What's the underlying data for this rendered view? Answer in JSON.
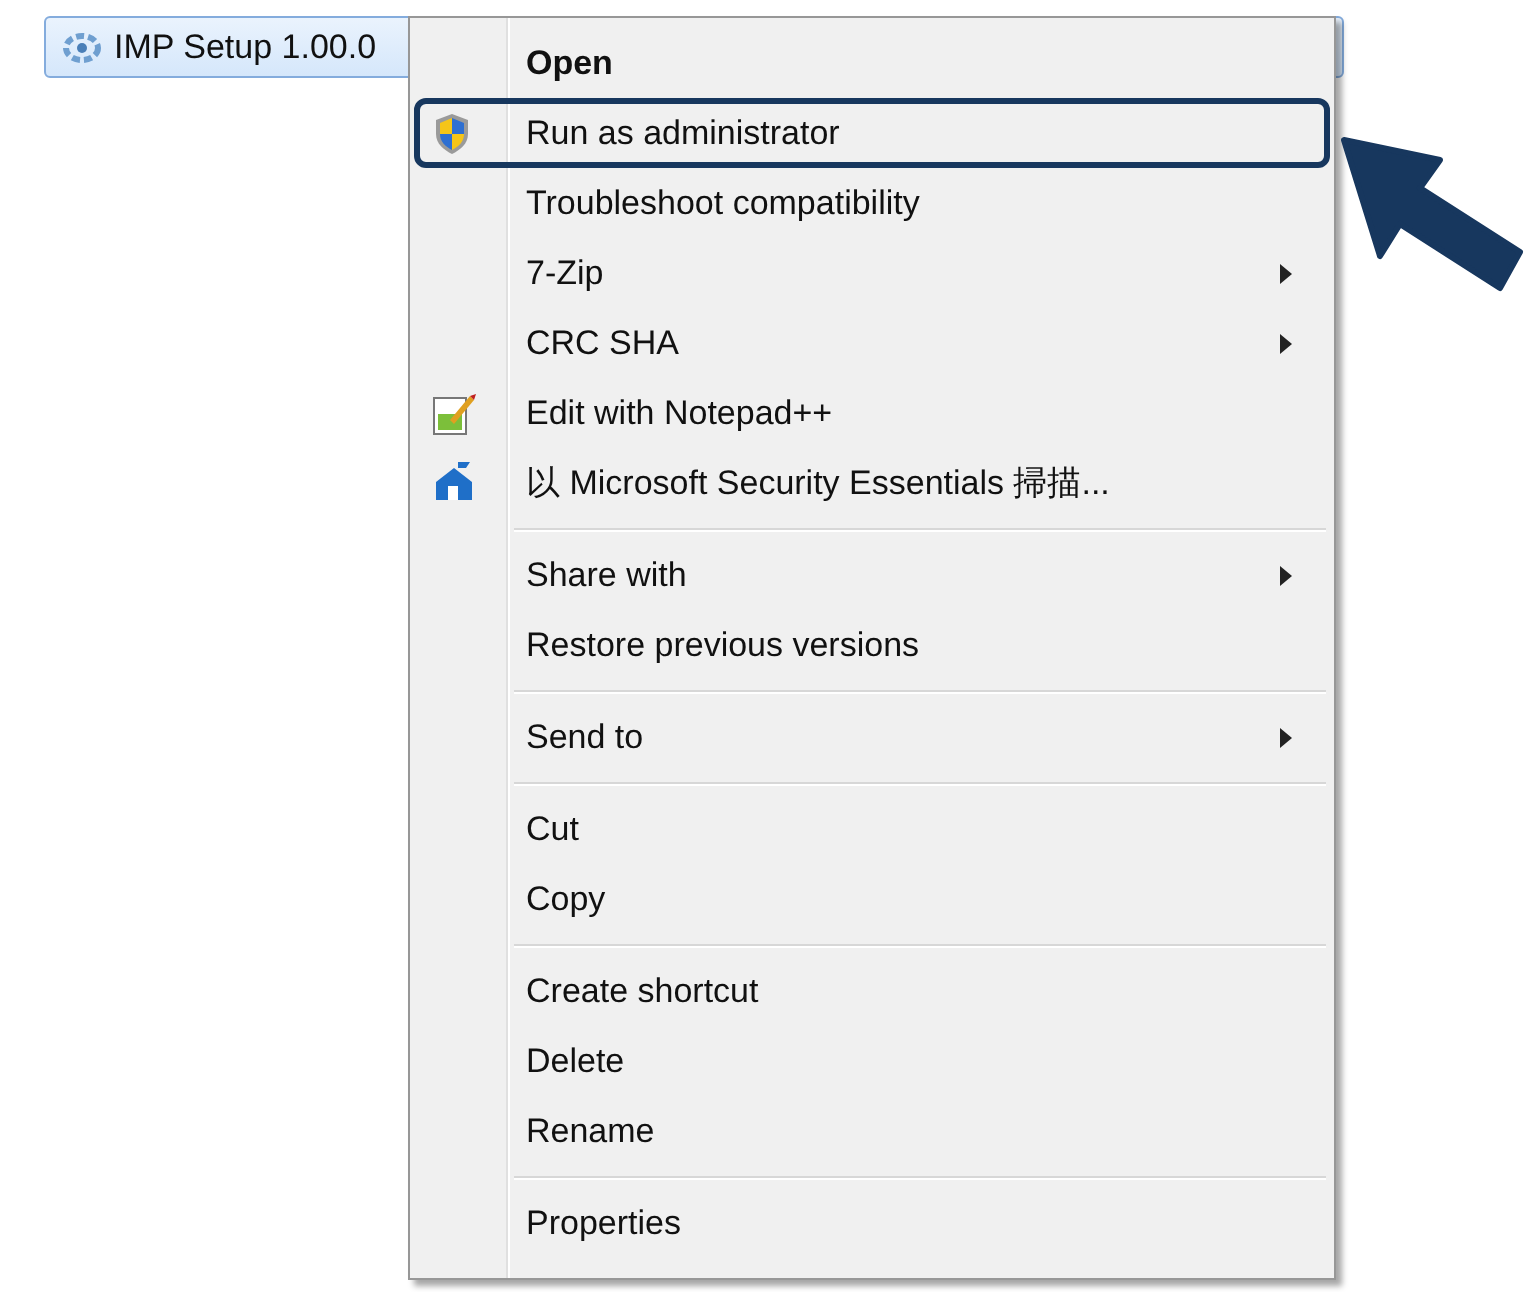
{
  "file": {
    "name": "IMP Setup 1.00.0",
    "selected": true
  },
  "menu": {
    "groups": [
      {
        "items": [
          {
            "label": "Open",
            "default": true,
            "submenu": false,
            "highlighted": false
          },
          {
            "label": "Run as administrator",
            "default": false,
            "submenu": false,
            "highlighted": true
          },
          {
            "label": "Troubleshoot compatibility",
            "default": false,
            "submenu": false,
            "highlighted": false
          },
          {
            "label": "7-Zip",
            "default": false,
            "submenu": true,
            "highlighted": false
          },
          {
            "label": "CRC SHA",
            "default": false,
            "submenu": true,
            "highlighted": false
          },
          {
            "label": "Edit with Notepad++",
            "default": false,
            "submenu": false,
            "highlighted": false
          },
          {
            "label": "以 Microsoft Security Essentials 掃描...",
            "default": false,
            "submenu": false,
            "highlighted": false
          }
        ]
      },
      {
        "items": [
          {
            "label": "Share with",
            "default": false,
            "submenu": true,
            "highlighted": false
          },
          {
            "label": "Restore previous versions",
            "default": false,
            "submenu": false,
            "highlighted": false
          }
        ]
      },
      {
        "items": [
          {
            "label": "Send to",
            "default": false,
            "submenu": true,
            "highlighted": false
          }
        ]
      },
      {
        "items": [
          {
            "label": "Cut",
            "default": false,
            "submenu": false,
            "highlighted": false
          },
          {
            "label": "Copy",
            "default": false,
            "submenu": false,
            "highlighted": false
          }
        ]
      },
      {
        "items": [
          {
            "label": "Create shortcut",
            "default": false,
            "submenu": false,
            "highlighted": false
          },
          {
            "label": "Delete",
            "default": false,
            "submenu": false,
            "highlighted": false
          },
          {
            "label": "Rename",
            "default": false,
            "submenu": false,
            "highlighted": false
          }
        ]
      },
      {
        "items": [
          {
            "label": "Properties",
            "default": false,
            "submenu": false,
            "highlighted": false
          }
        ]
      }
    ]
  }
}
